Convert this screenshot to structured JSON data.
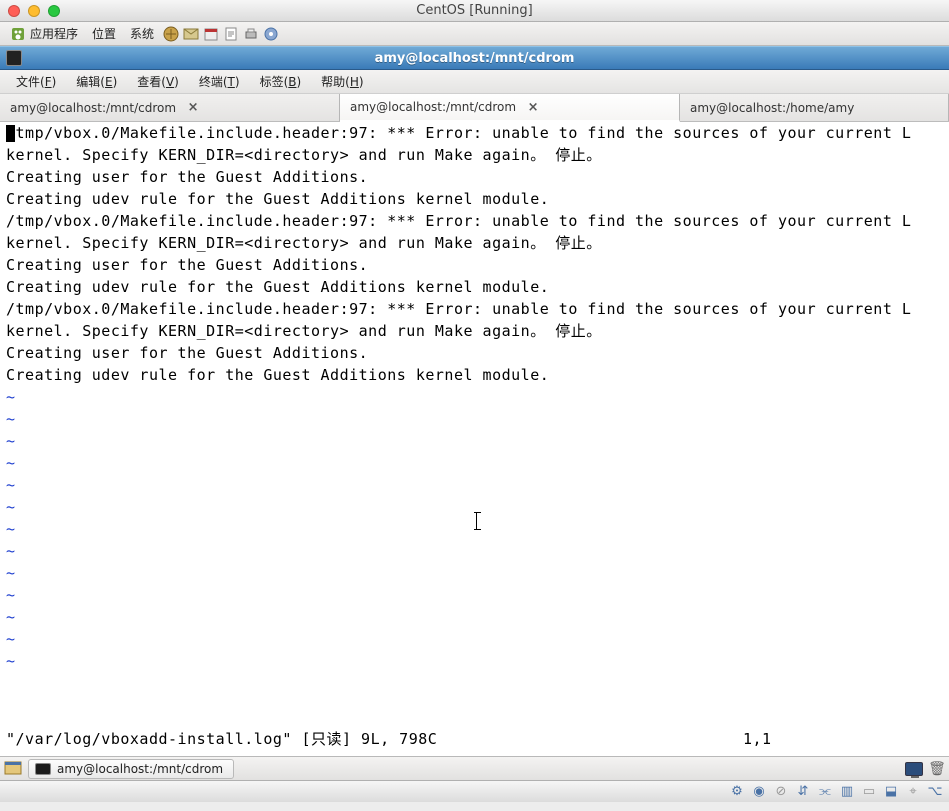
{
  "mac": {
    "title": "CentOS [Running]"
  },
  "gnome_panel": {
    "apps": "应用程序",
    "places": "位置",
    "system": "系统"
  },
  "terminal_title": "amy@localhost:/mnt/cdrom",
  "menus": {
    "file": "文件(F)",
    "edit": "编辑(E)",
    "view": "查看(V)",
    "terminal": "终端(T)",
    "tabs": "标签(B)",
    "help": "帮助(H)"
  },
  "tabs": [
    {
      "label": "amy@localhost:/mnt/cdrom",
      "closable": true,
      "active": false
    },
    {
      "label": "amy@localhost:/mnt/cdrom",
      "closable": true,
      "active": true
    },
    {
      "label": "amy@localhost:/home/amy",
      "closable": false,
      "active": false
    }
  ],
  "terminal_lines": [
    " tmp/vbox.0/Makefile.include.header:97: *** Error: unable to find the sources of your current L",
    "kernel. Specify KERN_DIR=<directory> and run Make again。 停止。",
    "Creating user for the Guest Additions.",
    "Creating udev rule for the Guest Additions kernel module.",
    "/tmp/vbox.0/Makefile.include.header:97: *** Error: unable to find the sources of your current L",
    "kernel. Specify KERN_DIR=<directory> and run Make again。 停止。",
    "Creating user for the Guest Additions.",
    "Creating udev rule for the Guest Additions kernel module.",
    "/tmp/vbox.0/Makefile.include.header:97: *** Error: unable to find the sources of your current L",
    "kernel. Specify KERN_DIR=<directory> and run Make again。 停止。",
    "Creating user for the Guest Additions.",
    "Creating udev rule for the Guest Additions kernel module."
  ],
  "tilde_count": 13,
  "vim_status": {
    "left": "\"/var/log/vboxadd-install.log\" [只读] 9L, 798C",
    "pos": "1,1"
  },
  "taskbar": {
    "window_label": "amy@localhost:/mnt/cdrom"
  }
}
